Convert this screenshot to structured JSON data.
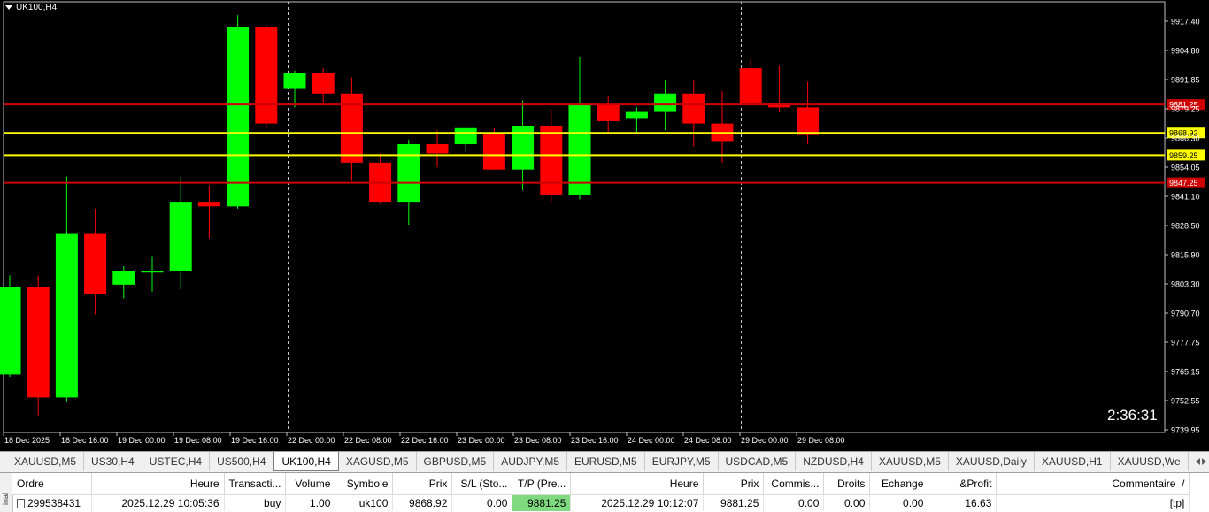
{
  "chart": {
    "title": "UK100,H4",
    "countdown": "2:36:31",
    "price_axis": [
      "9917.40",
      "9904.80",
      "9891.85",
      "9879.25",
      "9866.30",
      "9854.05",
      "9841.10",
      "9828.50",
      "9815.90",
      "9803.30",
      "9790.70",
      "9777.75",
      "9765.15",
      "9752.55",
      "9739.95"
    ],
    "time_axis": [
      "18 Dec 2025",
      "18 Dec 16:00",
      "19 Dec 00:00",
      "19 Dec 08:00",
      "19 Dec 16:00",
      "22 Dec 00:00",
      "22 Dec 08:00",
      "22 Dec 16:00",
      "23 Dec 00:00",
      "23 Dec 08:00",
      "23 Dec 16:00",
      "24 Dec 00:00",
      "24 Dec 08:00",
      "29 Dec 00:00",
      "29 Dec 08:00"
    ],
    "levels": [
      {
        "price": 9881.25,
        "label": "9881.25",
        "color": "#cc0000"
      },
      {
        "price": 9868.92,
        "label": "9868.92",
        "color": "#ffff00"
      },
      {
        "price": 9859.25,
        "label": "9859.25",
        "color": "#ffff00"
      },
      {
        "price": 9847.25,
        "label": "9847.25",
        "color": "#cc0000"
      }
    ],
    "colors": {
      "bull": "#00ff00",
      "bear": "#ff0000",
      "background": "#000000",
      "axis_text": "#ffffff"
    },
    "candles": [
      {
        "o": 9764.0,
        "h": 9807.0,
        "l": 9763.0,
        "c": 9802.0
      },
      {
        "o": 9802.0,
        "h": 9807.0,
        "l": 9746.0,
        "c": 9754.0
      },
      {
        "o": 9754.0,
        "h": 9850.0,
        "l": 9752.0,
        "c": 9825.0
      },
      {
        "o": 9825.0,
        "h": 9836.0,
        "l": 9790.0,
        "c": 9799.0
      },
      {
        "o": 9803.0,
        "h": 9811.0,
        "l": 9797.0,
        "c": 9809.0
      },
      {
        "o": 9809.0,
        "h": 9815.0,
        "l": 9800.0,
        "c": 9809.0
      },
      {
        "o": 9809.0,
        "h": 9850.0,
        "l": 9801.0,
        "c": 9839.0
      },
      {
        "o": 9839.0,
        "h": 9846.0,
        "l": 9823.0,
        "c": 9837.0
      },
      {
        "o": 9837.0,
        "h": 9920.0,
        "l": 9836.0,
        "c": 9915.0
      },
      {
        "o": 9915.0,
        "h": 9916.0,
        "l": 9871.0,
        "c": 9873.0
      },
      {
        "o": 9888.0,
        "h": 9896.0,
        "l": 9880.0,
        "c": 9895.0
      },
      {
        "o": 9895.0,
        "h": 9897.0,
        "l": 9882.0,
        "c": 9886.0
      },
      {
        "o": 9886.0,
        "h": 9893.0,
        "l": 9848.0,
        "c": 9856.0
      },
      {
        "o": 9856.0,
        "h": 9860.0,
        "l": 9838.0,
        "c": 9839.0
      },
      {
        "o": 9839.0,
        "h": 9866.0,
        "l": 9829.0,
        "c": 9864.0
      },
      {
        "o": 9864.0,
        "h": 9870.0,
        "l": 9854.0,
        "c": 9860.0
      },
      {
        "o": 9864.0,
        "h": 9871.0,
        "l": 9861.0,
        "c": 9871.0
      },
      {
        "o": 9869.0,
        "h": 9871.0,
        "l": 9853.0,
        "c": 9853.0
      },
      {
        "o": 9853.0,
        "h": 9883.0,
        "l": 9844.0,
        "c": 9872.0
      },
      {
        "o": 9872.0,
        "h": 9879.0,
        "l": 9839.0,
        "c": 9842.0
      },
      {
        "o": 9842.0,
        "h": 9902.0,
        "l": 9840.0,
        "c": 9881.0
      },
      {
        "o": 9881.0,
        "h": 9885.0,
        "l": 9869.0,
        "c": 9874.0
      },
      {
        "o": 9875.0,
        "h": 9880.0,
        "l": 9869.0,
        "c": 9878.0
      },
      {
        "o": 9878.0,
        "h": 9892.0,
        "l": 9870.0,
        "c": 9886.0
      },
      {
        "o": 9886.0,
        "h": 9892.0,
        "l": 9863.0,
        "c": 9873.0
      },
      {
        "o": 9873.0,
        "h": 9887.0,
        "l": 9856.0,
        "c": 9865.0
      },
      {
        "o": 9897.0,
        "h": 9901.0,
        "l": 9881.0,
        "c": 9882.0
      },
      {
        "o": 9882.0,
        "h": 9898.0,
        "l": 9878.0,
        "c": 9880.0
      },
      {
        "o": 9880.0,
        "h": 9891.0,
        "l": 9864.0,
        "c": 9868.0
      }
    ]
  },
  "tabs": [
    "XAUUSD,M5",
    "US30,H4",
    "USTEC,H4",
    "US500,H4",
    "UK100,H4",
    "XAGUSD,M5",
    "GBPUSD,M5",
    "AUDJPY,M5",
    "EURUSD,M5",
    "EURJPY,M5",
    "USDCAD,M5",
    "NZDUSD,H4",
    "XAUUSD,M5",
    "XAUUSD,Daily",
    "XAUUSD,H1",
    "XAUUSD,We"
  ],
  "active_tab": "UK100,H4",
  "terminal": {
    "side_label": "inal",
    "headers": [
      "Ordre",
      "Heure",
      "Transacti...",
      "Volume",
      "Symbole",
      "Prix",
      "S/L (Sto...",
      "T/P (Pre...",
      "Heure",
      "Prix",
      "Commis...",
      "Droits",
      "Echange",
      "&Profit",
      "Commentaire"
    ],
    "sort_mark": "/",
    "row": [
      "299538431",
      "2025.12.29 10:05:36",
      "buy",
      "1.00",
      "uk100",
      "9868.92",
      "0.00",
      "9881.25",
      "2025.12.29 10:12:07",
      "9881.25",
      "0.00",
      "0.00",
      "0.00",
      "16.63",
      "[tp]"
    ]
  }
}
